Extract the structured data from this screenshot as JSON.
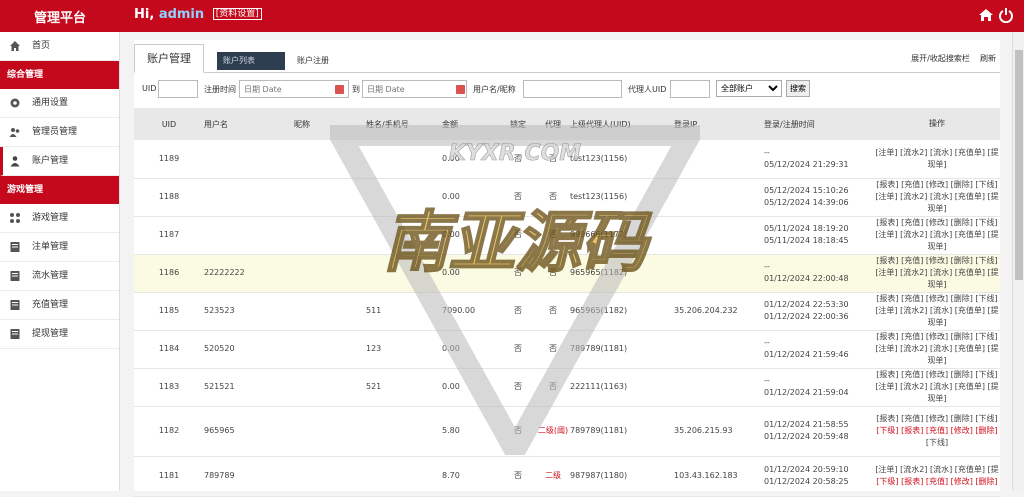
{
  "header": {
    "brand": "管理平台",
    "hi": "Hi,",
    "admin": "admin",
    "settings": "[资料设置]",
    "home_icon": "home-icon",
    "power_icon": "power-icon"
  },
  "sidebar": {
    "home": "首页",
    "group1": "综合管理",
    "general": "通用设置",
    "admins": "管理员管理",
    "accounts": "账户管理",
    "group2": "游戏管理",
    "games": "游戏管理",
    "orders": "注单管理",
    "flow": "流水管理",
    "recharge": "充值管理",
    "withdraw": "提现管理"
  },
  "tabs": {
    "title": "账户管理",
    "list": "账户列表",
    "register": "账户注册",
    "toggle": "展开/收起搜索栏",
    "refresh": "刷新"
  },
  "search": {
    "uid_label": "UID",
    "time_label": "注册时间",
    "date_placeholder": "日期 Date",
    "to_label": "到",
    "user_label": "用户名/昵称",
    "agent_label": "代理人UID",
    "select_value": "全部账户",
    "search_button": "搜索"
  },
  "table": {
    "headers": [
      "UID",
      "用户名",
      "昵称",
      "姓名/手机号",
      "金额",
      "锁定",
      "代理",
      "上级代理人(UID)",
      "登录IP",
      "登录/注册时间",
      "操作"
    ],
    "rows": [
      {
        "uid": "1189",
        "user": "",
        "nick": "",
        "name": "",
        "balance": "0.00",
        "lock": "否",
        "agent": "否",
        "up": "test123(1156)",
        "ip": "",
        "t1": "--",
        "t2": "05/12/2024 21:29:31",
        "ops1": "[注单] [流水2] [流水] [充值单] [提",
        "ops2": "现单]",
        "ops3": ""
      },
      {
        "uid": "1188",
        "user": "",
        "nick": "",
        "name": "",
        "balance": "0.00",
        "lock": "否",
        "agent": "否",
        "up": "test123(1156)",
        "ip": "",
        "t1": "05/12/2024 15:10:26",
        "t2": "05/12/2024 14:39:06",
        "ops1": "[报表] [充值] [修改] [删除] [下线]",
        "ops2": "[注单] [流水2] [流水] [充值单] [提",
        "ops3": "现单]"
      },
      {
        "uid": "1187",
        "user": "",
        "nick": "",
        "name": "",
        "balance": "0.00",
        "lock": "否",
        "agent": "否",
        "up": "999666(1172)",
        "ip": "",
        "t1": "05/11/2024 18:19:20",
        "t2": "05/11/2024 18:18:45",
        "ops1": "[报表] [充值] [修改] [删除] [下线]",
        "ops2": "[注单] [流水2] [流水] [充值单] [提",
        "ops3": "现单]"
      },
      {
        "uid": "1186",
        "user": "22222222",
        "nick": "",
        "name": "",
        "balance": "0.00",
        "lock": "否",
        "agent": "否",
        "up": "965965(1182)",
        "ip": "",
        "t1": "--",
        "t2": "01/12/2024 22:00:48",
        "ops1": "[报表] [充值] [修改] [删除] [下线]",
        "ops2": "[注单] [流水2] [流水] [充值单] [提",
        "ops3": "现单]"
      },
      {
        "uid": "1185",
        "user": "523523",
        "nick": "",
        "name": "511",
        "balance": "7090.00",
        "lock": "否",
        "agent": "否",
        "up": "965965(1182)",
        "ip": "35.206.204.232",
        "t1": "01/12/2024 22:53:30",
        "t2": "01/12/2024 22:00:36",
        "ops1": "[报表] [充值] [修改] [删除] [下线]",
        "ops2": "[注单] [流水2] [流水] [充值单] [提",
        "ops3": "现单]"
      },
      {
        "uid": "1184",
        "user": "520520",
        "nick": "",
        "name": "123",
        "balance": "0.00",
        "lock": "否",
        "agent": "否",
        "up": "789789(1181)",
        "ip": "",
        "t1": "--",
        "t2": "01/12/2024 21:59:46",
        "ops1": "[报表] [充值] [修改] [删除] [下线]",
        "ops2": "[注单] [流水2] [流水] [充值单] [提",
        "ops3": "现单]"
      },
      {
        "uid": "1183",
        "user": "521521",
        "nick": "",
        "name": "521",
        "balance": "0.00",
        "lock": "否",
        "agent": "否",
        "up": "222111(1163)",
        "ip": "",
        "t1": "--",
        "t2": "01/12/2024 21:59:04",
        "ops1": "[报表] [充值] [修改] [删除] [下线]",
        "ops2": "[注单] [流水2] [流水] [充值单] [提",
        "ops3": "现单]"
      },
      {
        "uid": "1182",
        "user": "965965",
        "nick": "",
        "name": "",
        "balance": "5.80",
        "lock": "否",
        "agent": "二级(阈)",
        "up": "789789(1181)",
        "ip": "35.206.215.93",
        "t1": "01/12/2024 21:58:55",
        "t2": "01/12/2024 20:59:48",
        "ops1": "[报表] [充值] [修改] [删除] [下线]",
        "ops2": "[下级] [报表] [充值] [修改] [删除]",
        "ops3": "[下线]"
      },
      {
        "uid": "1181",
        "user": "789789",
        "nick": "",
        "name": "",
        "balance": "8.70",
        "lock": "否",
        "agent": "二级",
        "up": "987987(1180)",
        "ip": "103.43.162.183",
        "t1": "01/12/2024 20:59:10",
        "t2": "01/12/2024 20:58:25",
        "ops1": "[注单] [流水2] [流水] [充值单] [提",
        "ops2": "[下级] [报表] [充值] [修改] [删除]",
        "ops3": ""
      }
    ]
  },
  "watermark": {
    "url_text": "KYXR.COM",
    "big_text": "南亚源码"
  }
}
